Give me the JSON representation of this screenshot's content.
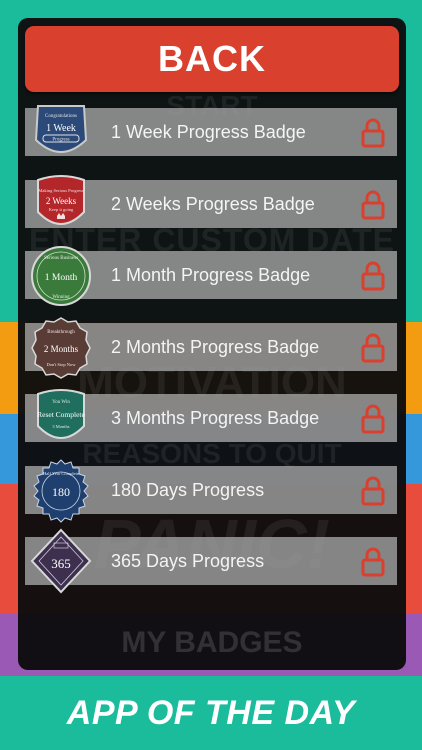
{
  "background_ghost": {
    "start": "START",
    "custom_date": "ENTER CUSTOM DATE",
    "motivation": "MOTIVATION",
    "reasons": "REASONS TO QUIT",
    "panic": "PANIC!",
    "my_badges": "MY BADGES"
  },
  "back_label": "BACK",
  "badges": [
    {
      "label": "1 Week Progress Badge",
      "icon": "1-week-badge-icon",
      "badge_top": "Congratulations",
      "badge_main": "1 Week",
      "badge_bottom": "Progress",
      "color": "#2b4a7a",
      "locked": true
    },
    {
      "label": "2 Weeks Progress Badge",
      "icon": "2-weeks-badge-icon",
      "badge_top": "Making Serious Progress",
      "badge_main": "2 Weeks",
      "badge_bottom": "Keep it going",
      "color": "#b3262a",
      "locked": true
    },
    {
      "label": "1 Month Progress Badge",
      "icon": "1-month-badge-icon",
      "badge_top": "Serious Business",
      "badge_main": "1 Month",
      "badge_bottom": "Winning",
      "color": "#3a7a3a",
      "locked": true
    },
    {
      "label": "2 Months Progress Badge",
      "icon": "2-months-badge-icon",
      "badge_top": "Breakthrough",
      "badge_main": "2 Months",
      "badge_bottom": "Don't Stop Now",
      "color": "#5a3c36",
      "locked": true
    },
    {
      "label": "3 Months Progress Badge",
      "icon": "3-months-badge-icon",
      "badge_top": "You Win",
      "badge_main": "Reset Complete",
      "badge_bottom": "3 Months",
      "color": "#1f6e5e",
      "locked": true
    },
    {
      "label": "180 Days Progress",
      "icon": "180-days-badge-icon",
      "badge_top": "Half Year Complete",
      "badge_main": "180",
      "badge_bottom": "",
      "color": "#1f3f6e",
      "locked": true
    },
    {
      "label": "365 Days Progress",
      "icon": "365-days-badge-icon",
      "badge_top": "",
      "badge_main": "365",
      "badge_bottom": "",
      "color": "#3d2f4e",
      "locked": true
    }
  ],
  "lock_icon": "lock-icon",
  "lock_color": "#d9402e",
  "footer_label": "APP OF THE DAY"
}
